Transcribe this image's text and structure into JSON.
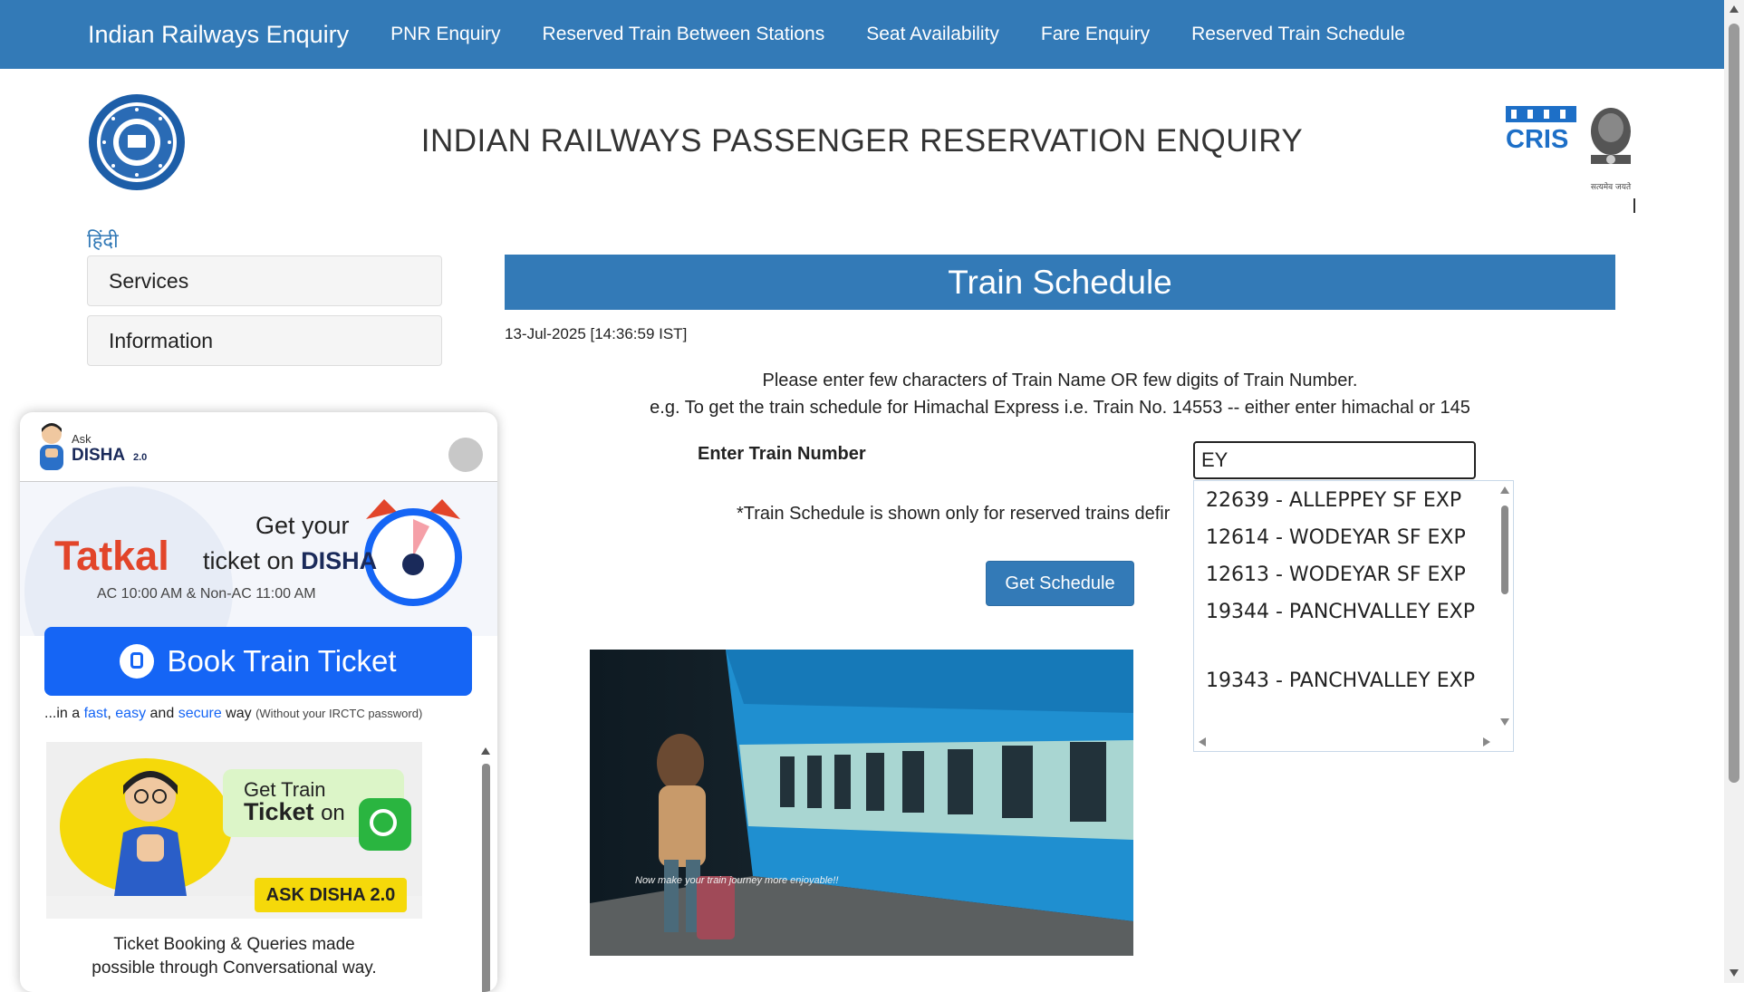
{
  "navbar": {
    "brand": "Indian Railways Enquiry",
    "links": [
      "PNR Enquiry",
      "Reserved Train Between Stations",
      "Seat Availability",
      "Fare Enquiry",
      "Reserved Train Schedule"
    ],
    "color": "#337ab7"
  },
  "header": {
    "title": "INDIAN RAILWAYS PASSENGER RESERVATION ENQUIRY",
    "cris_text": "CRIS",
    "emblem_motto": "सत्यमेव जयते"
  },
  "sidebar": {
    "language_link": "हिंदी",
    "panels": [
      "Services",
      "Information"
    ]
  },
  "main": {
    "section_title": "Train Schedule",
    "timestamp": "13-Jul-2025 [14:36:59 IST]",
    "instruction_line1": "Please enter few characters of Train Name OR few digits of Train Number.",
    "instruction_line2": "e.g. To get the train schedule for Himachal Express i.e. Train No. 14553 -- either enter himachal or 145",
    "train_label": "Enter Train Number",
    "train_input_value": "EY",
    "note": "*Train Schedule is shown only for reserved trains defir",
    "get_schedule_label": "Get Schedule",
    "photo_caption": "Now make your train journey more enjoyable!!"
  },
  "autocomplete": {
    "items": [
      "22639 - ALLEPPEY SF EXP",
      "12614 - WODEYAR SF EXP",
      "12613 - WODEYAR SF EXP",
      "19344 - PANCHVALLEY EXP",
      "19343 - PANCHVALLEY EXP"
    ]
  },
  "disha": {
    "ask": "Ask",
    "name": "DISHA",
    "version": "2.0",
    "get_your": "Get your",
    "tatkal": "Tatkal",
    "ticket_on": "ticket on",
    "ticket_on_brand": "DISHA",
    "timing": "AC 10:00 AM & Non-AC 11:00 AM",
    "book_button": "Book Train Ticket",
    "tagline_prefix": "...in a",
    "tagline_fast": "fast",
    "tagline_easy": "easy",
    "tagline_and": "and",
    "tagline_secure": "secure",
    "tagline_way": "way",
    "tagline_note": "(Without your IRCTC password)",
    "ad_get_train": "Get Train",
    "ad_ticket": "Ticket",
    "ad_on": "on",
    "ad_tag": "ASK DISHA 2.0",
    "ad_desc_line1": "Ticket Booking & Queries made",
    "ad_desc_line2": "possible through Conversational way.",
    "brand_color": "#1565f5",
    "tatkal_color": "#e2452a"
  }
}
